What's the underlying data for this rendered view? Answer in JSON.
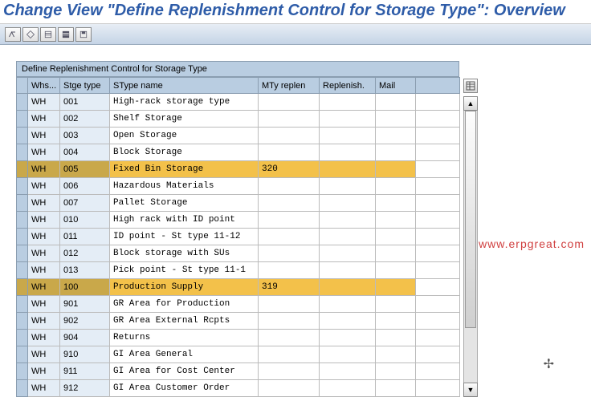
{
  "title": "Change View \"Define Replenishment Control for Storage Type\": Overview",
  "table_title": "Define Replenishment Control for Storage Type",
  "columns": {
    "whs": "Whs...",
    "stge": "Stge type",
    "stype": "SType name",
    "mty": "MTy replen",
    "replen": "Replenish.",
    "mail": "Mail"
  },
  "rows": [
    {
      "whs": "WH",
      "stge": "001",
      "stype": "High-rack storage type",
      "mty": "",
      "replen": "",
      "mail": "",
      "hl": false
    },
    {
      "whs": "WH",
      "stge": "002",
      "stype": "Shelf Storage",
      "mty": "",
      "replen": "",
      "mail": "",
      "hl": false
    },
    {
      "whs": "WH",
      "stge": "003",
      "stype": "Open Storage",
      "mty": "",
      "replen": "",
      "mail": "",
      "hl": false
    },
    {
      "whs": "WH",
      "stge": "004",
      "stype": "Block Storage",
      "mty": "",
      "replen": "",
      "mail": "",
      "hl": false
    },
    {
      "whs": "WH",
      "stge": "005",
      "stype": "Fixed Bin Storage",
      "mty": "320",
      "replen": "",
      "mail": "",
      "hl": true
    },
    {
      "whs": "WH",
      "stge": "006",
      "stype": "Hazardous Materials",
      "mty": "",
      "replen": "",
      "mail": "",
      "hl": false
    },
    {
      "whs": "WH",
      "stge": "007",
      "stype": "Pallet Storage",
      "mty": "",
      "replen": "",
      "mail": "",
      "hl": false
    },
    {
      "whs": "WH",
      "stge": "010",
      "stype": "High rack with ID point",
      "mty": "",
      "replen": "",
      "mail": "",
      "hl": false
    },
    {
      "whs": "WH",
      "stge": "011",
      "stype": "ID point - St type 11-12",
      "mty": "",
      "replen": "",
      "mail": "",
      "hl": false
    },
    {
      "whs": "WH",
      "stge": "012",
      "stype": "Block storage with SUs",
      "mty": "",
      "replen": "",
      "mail": "",
      "hl": false
    },
    {
      "whs": "WH",
      "stge": "013",
      "stype": "Pick point - St type 11-1",
      "mty": "",
      "replen": "",
      "mail": "",
      "hl": false
    },
    {
      "whs": "WH",
      "stge": "100",
      "stype": "Production Supply",
      "mty": "319",
      "replen": "",
      "mail": "",
      "hl": true
    },
    {
      "whs": "WH",
      "stge": "901",
      "stype": "GR Area for Production",
      "mty": "",
      "replen": "",
      "mail": "",
      "hl": false
    },
    {
      "whs": "WH",
      "stge": "902",
      "stype": "GR Area External Rcpts",
      "mty": "",
      "replen": "",
      "mail": "",
      "hl": false
    },
    {
      "whs": "WH",
      "stge": "904",
      "stype": "Returns",
      "mty": "",
      "replen": "",
      "mail": "",
      "hl": false
    },
    {
      "whs": "WH",
      "stge": "910",
      "stype": "GI Area General",
      "mty": "",
      "replen": "",
      "mail": "",
      "hl": false
    },
    {
      "whs": "WH",
      "stge": "911",
      "stype": "GI Area for Cost Center",
      "mty": "",
      "replen": "",
      "mail": "",
      "hl": false
    },
    {
      "whs": "WH",
      "stge": "912",
      "stype": "GI Area Customer Order",
      "mty": "",
      "replen": "",
      "mail": "",
      "hl": false
    }
  ],
  "watermark": "www.erpgreat.com"
}
